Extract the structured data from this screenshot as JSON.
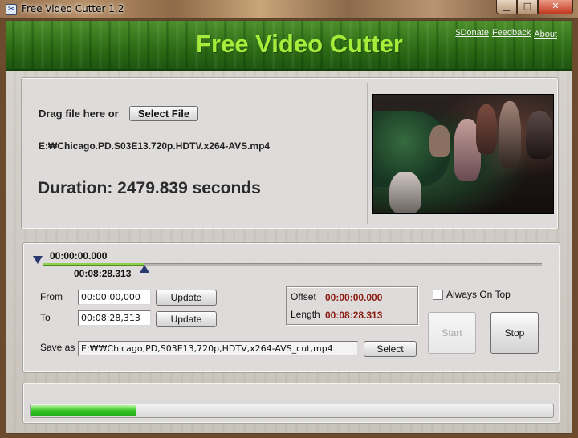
{
  "window": {
    "title": "Free Video Cutter 1.2",
    "icon": "scissors-icon",
    "min_symbol": "▁",
    "max_symbol": "□",
    "close_symbol": "✕"
  },
  "header": {
    "title": "Free Video Cutter",
    "links": {
      "donate": "$Donate",
      "feedback": "Feedback",
      "about": "About"
    },
    "accent_color": "#a6ec3a"
  },
  "file": {
    "drag_label": "Drag file here or",
    "select_button": "Select File",
    "path": "E:₩Chicago.PD.S03E13.720p.HDTV.x264-AVS.mp4",
    "duration": "Duration: 2479.839 seconds"
  },
  "timeline": {
    "start_time": "00:00:00.000",
    "end_time": "00:08:28.313",
    "end_fraction": 0.2049
  },
  "cut": {
    "from_label": "From",
    "from_value": "00:00:00,000",
    "to_label": "To",
    "to_value": "00:08:28,313",
    "update_label": "Update",
    "offset_label": "Offset",
    "offset_value": "00:00:00.000",
    "length_label": "Length",
    "length_value": "00:08:28.313",
    "always_on_top_label": "Always On Top",
    "always_on_top_checked": false,
    "start_label": "Start",
    "stop_label": "Stop",
    "save_label": "Save as",
    "save_value": "E:₩₩Chicago,PD,S03E13,720p,HDTV,x264-AVS_cut,mp4",
    "select_label": "Select"
  },
  "progress": {
    "fraction": 0.2
  }
}
